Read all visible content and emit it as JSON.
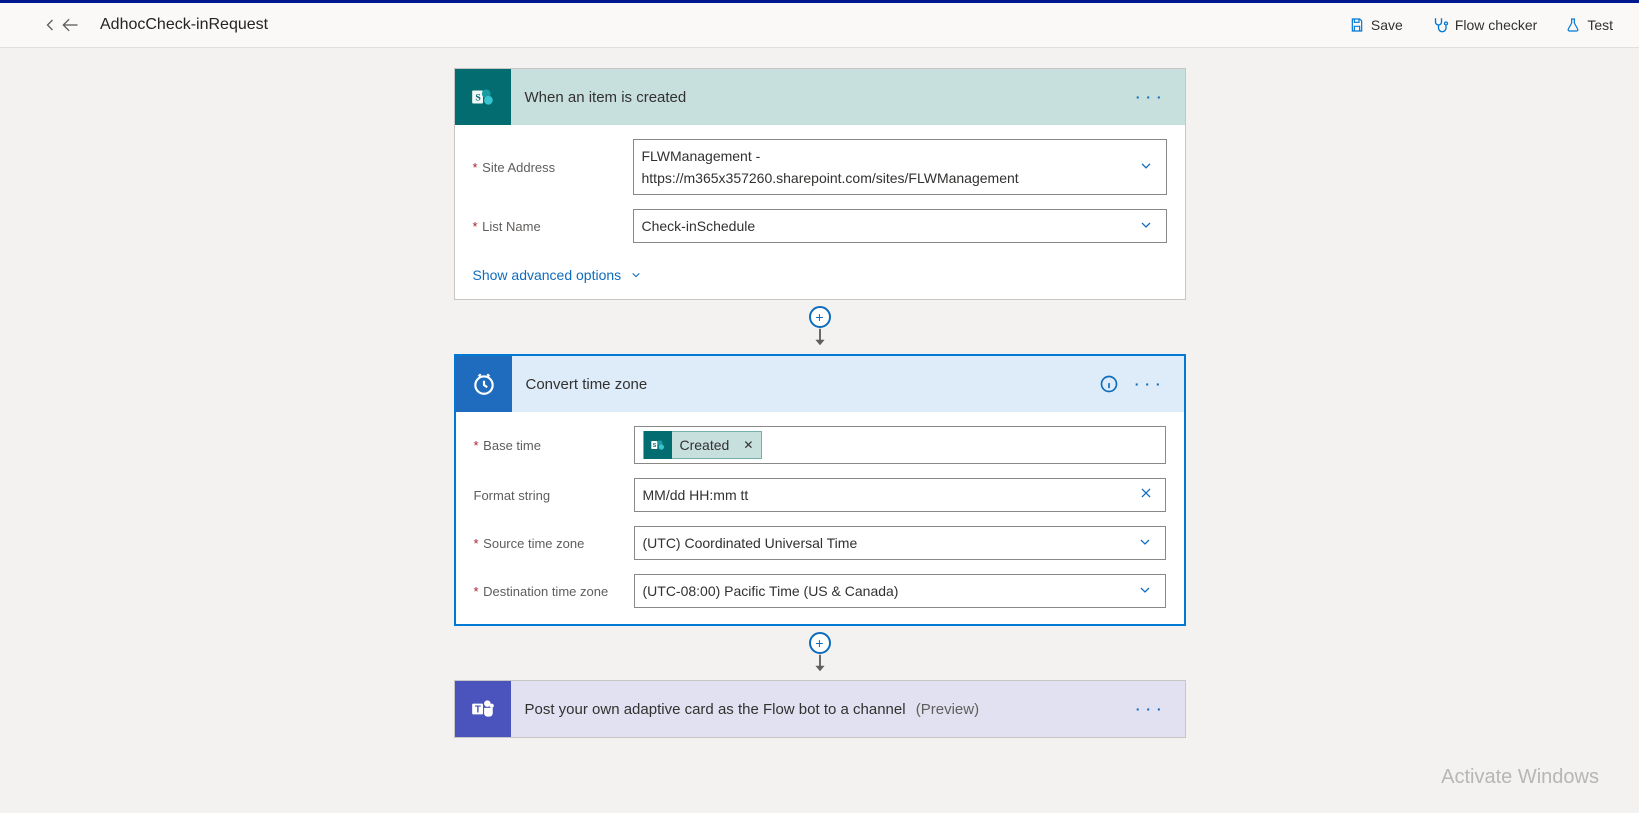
{
  "header": {
    "flow_name": "AdhocCheck-inRequest",
    "save_label": "Save",
    "checker_label": "Flow checker",
    "test_label": "Test"
  },
  "steps": {
    "trigger": {
      "title": "When an item is created",
      "site_address_label": "Site Address",
      "site_address_value_line1": "FLWManagement -",
      "site_address_value_line2": "https://m365x357260.sharepoint.com/sites/FLWManagement",
      "list_name_label": "List Name",
      "list_name_value": "Check-inSchedule",
      "advanced_label": "Show advanced options"
    },
    "convert": {
      "title": "Convert time zone",
      "base_time_label": "Base time",
      "base_time_token": "Created",
      "format_label": "Format string",
      "format_value": "MM/dd   HH:mm  tt",
      "source_tz_label": "Source time zone",
      "source_tz_value": "(UTC) Coordinated Universal Time",
      "dest_tz_label": "Destination time zone",
      "dest_tz_value": "(UTC-08:00) Pacific Time (US & Canada)"
    },
    "teams": {
      "title": "Post your own adaptive card as the Flow bot to a channel",
      "preview": "(Preview)"
    }
  },
  "watermark": "Activate Windows"
}
